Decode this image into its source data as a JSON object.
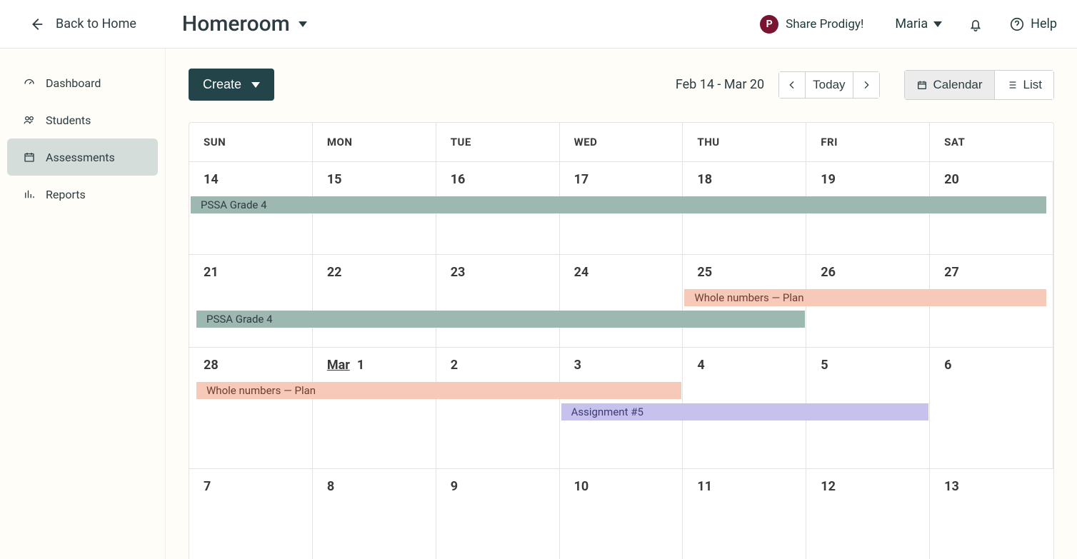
{
  "header": {
    "back_label": "Back to Home",
    "class_name": "Homeroom",
    "share_label": "Share Prodigy!",
    "user_name": "Maria",
    "help_label": "Help"
  },
  "sidebar": {
    "items": [
      {
        "label": "Dashboard"
      },
      {
        "label": "Students"
      },
      {
        "label": "Assessments"
      },
      {
        "label": "Reports"
      }
    ]
  },
  "toolbar": {
    "create_label": "Create",
    "date_range": "Feb 14 - Mar 20",
    "today_label": "Today",
    "calendar_label": "Calendar",
    "list_label": "List"
  },
  "calendar": {
    "day_headers": [
      "SUN",
      "MON",
      "TUE",
      "WED",
      "THU",
      "FRI",
      "SAT"
    ],
    "weeks": [
      {
        "days": [
          "14",
          "15",
          "16",
          "17",
          "18",
          "19",
          "20"
        ]
      },
      {
        "days": [
          "21",
          "22",
          "23",
          "24",
          "25",
          "26",
          "27"
        ]
      },
      {
        "days": [
          "28",
          "Mar 1",
          "2",
          "3",
          "4",
          "5",
          "6"
        ],
        "month_start_col": 1,
        "month_label": "Mar"
      },
      {
        "days": [
          "7",
          "8",
          "9",
          "10",
          "11",
          "12",
          "13"
        ]
      }
    ],
    "events": [
      {
        "label": "PSSA Grade 4",
        "week": 0,
        "colStart": 0,
        "colEnd": 7,
        "row": 0,
        "color": "teal",
        "arrowLeft": false,
        "arrowRight": true
      },
      {
        "label": "PSSA Grade 4",
        "week": 1,
        "colStart": 0,
        "colEnd": 5,
        "row": 1,
        "color": "teal",
        "arrowLeft": true,
        "arrowRight": false
      },
      {
        "label": "Whole numbers — Plan",
        "week": 1,
        "colStart": 4,
        "colEnd": 7,
        "row": 0,
        "color": "peach",
        "arrowLeft": false,
        "arrowRight": true
      },
      {
        "label": "Whole numbers — Plan",
        "week": 2,
        "colStart": 0,
        "colEnd": 4,
        "row": 0,
        "color": "peach",
        "arrowLeft": true,
        "arrowRight": false
      },
      {
        "label": "Assignment #5",
        "week": 2,
        "colStart": 3,
        "colEnd": 6,
        "row": 1,
        "color": "lilac",
        "arrowLeft": false,
        "arrowRight": false
      }
    ],
    "palette": {
      "teal": {
        "bg": "#9db7b1",
        "fg": "#2d3c40"
      },
      "peach": {
        "bg": "#f7c9b8",
        "fg": "#6d3e2e"
      },
      "lilac": {
        "bg": "#c6c2ed",
        "fg": "#3e3a72"
      }
    }
  }
}
